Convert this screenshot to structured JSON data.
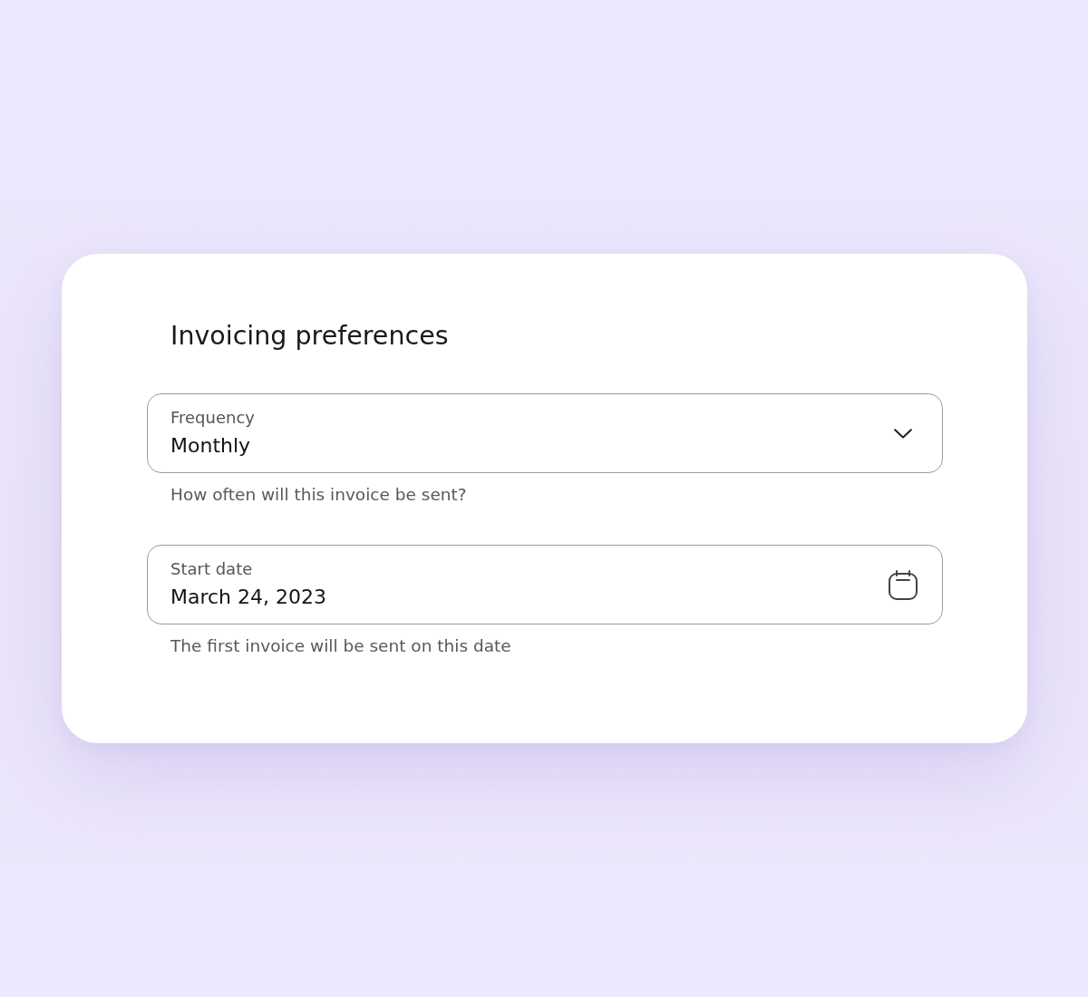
{
  "card": {
    "title": "Invoicing preferences",
    "fields": [
      {
        "kind": "select",
        "label": "Frequency",
        "value": "Monthly",
        "helper": "How often will this invoice be sent?"
      },
      {
        "kind": "date",
        "label": "Start date",
        "value": "March 24, 2023",
        "helper": "The first invoice will be sent on this date"
      }
    ]
  }
}
